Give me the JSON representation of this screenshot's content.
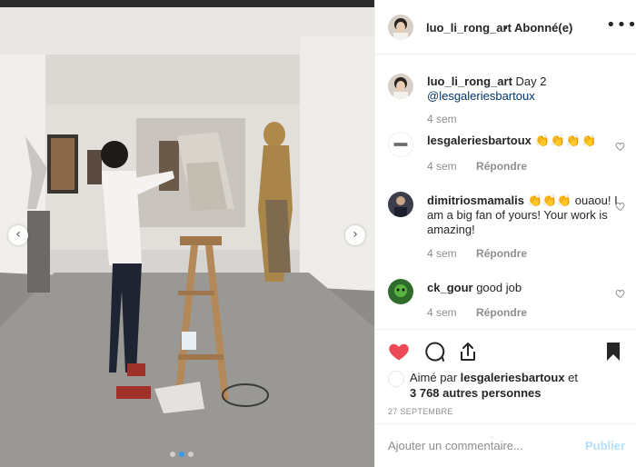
{
  "header": {
    "username": "luo_li_rong_art",
    "separator": "•",
    "follow_status": "Abonné(e)",
    "more_label": "•••"
  },
  "caption": {
    "username": "luo_li_rong_art",
    "text": "Day 2",
    "mention": "@lesgaleriesbartoux",
    "time": "4 sem"
  },
  "comments": [
    {
      "username": "lesgaleriesbartoux",
      "text": "👏👏👏👏",
      "time": "4 sem",
      "reply_label": "Répondre"
    },
    {
      "username": "dimitriosmamalis",
      "text": "👏👏👏 ouaou! I am a big fan of yours! Your work is amazing!",
      "time": "4 sem",
      "reply_label": "Répondre"
    },
    {
      "username": "ck_gour",
      "text": "good job",
      "time": "4 sem",
      "reply_label": "Répondre"
    }
  ],
  "likes": {
    "prefix": "Aimé par",
    "first_liker": "lesgaleriesbartoux",
    "conjunction": "et",
    "others": "3 768 autres personnes"
  },
  "date": "27 SEPTEMBRE",
  "add_comment": {
    "placeholder": "Ajouter un commentaire...",
    "post_label": "Publier"
  },
  "carousel": {
    "slide_count": 3,
    "active_index": 1
  },
  "icons": {
    "heart": "heart-filled-icon",
    "comment": "comment-icon",
    "share": "share-icon",
    "save": "bookmark-icon",
    "prev": "chevron-left-icon",
    "next": "chevron-right-icon"
  },
  "colors": {
    "like_red": "#ed4956",
    "link_blue": "#003569",
    "post_disabled": "#b2dffc",
    "muted": "#8e8e8e"
  }
}
